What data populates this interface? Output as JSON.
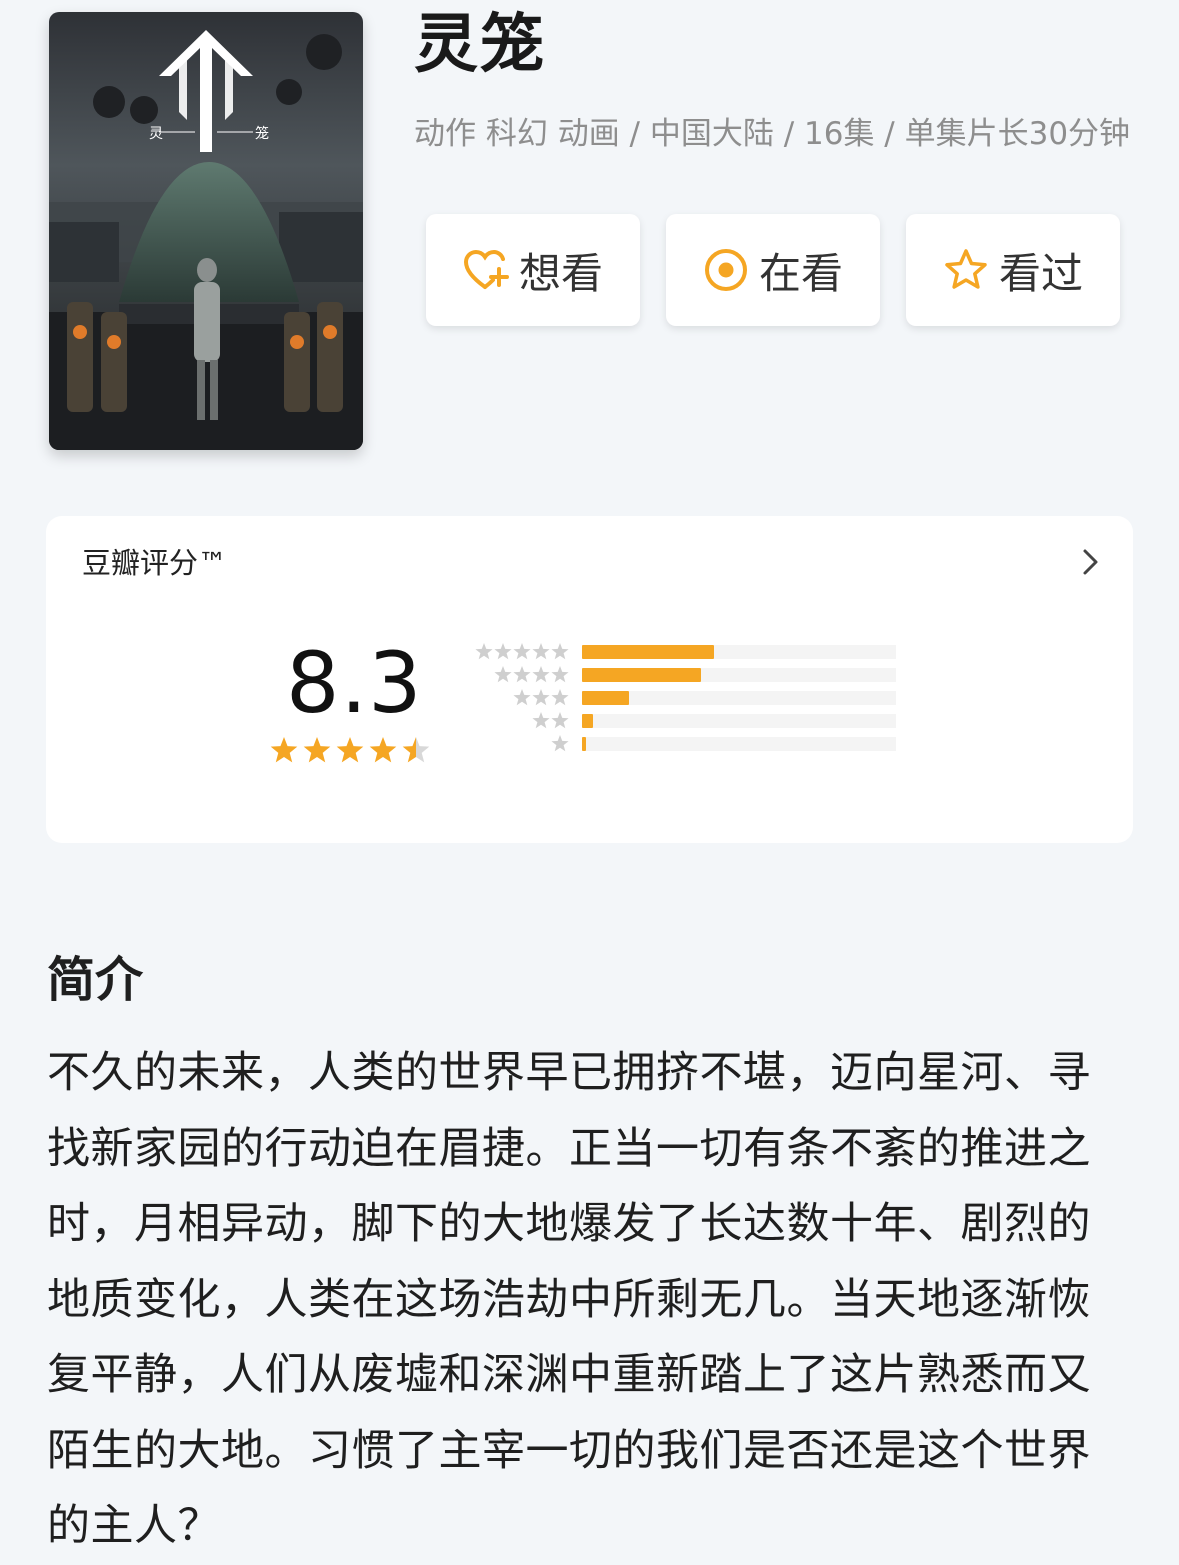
{
  "poster": {
    "logo_left_char": "灵",
    "logo_right_char": "笼"
  },
  "header": {
    "title": "灵笼",
    "meta": "动作 科幻 动画 / 中国大陆 / 16集 / 单集片长30分钟"
  },
  "actions": [
    {
      "label": "想看",
      "icon": "heart-plus-icon"
    },
    {
      "label": "在看",
      "icon": "target-icon"
    },
    {
      "label": "看过",
      "icon": "star-outline-icon"
    }
  ],
  "rating": {
    "title": "豆瓣评分™",
    "score": "8.3",
    "score_stars": 4.5,
    "distribution_fraction": [
      0.42,
      0.38,
      0.15,
      0.035,
      0.012
    ],
    "accent": "#f5a623"
  },
  "intro": {
    "title": "简介",
    "text": "不久的未来，人类的世界早已拥挤不堪，迈向星河、寻找新家园的行动迫在眉捷。正当一切有条不紊的推进之时，月相异动，脚下的大地爆发了长达数十年、剧烈的地质变化，人类在这场浩劫中所剩无几。当天地逐渐恢复平静，人们从废墟和深渊中重新踏上了这片熟悉而又陌生的大地。习惯了主宰一切的我们是否还是这个世界的主人？"
  }
}
